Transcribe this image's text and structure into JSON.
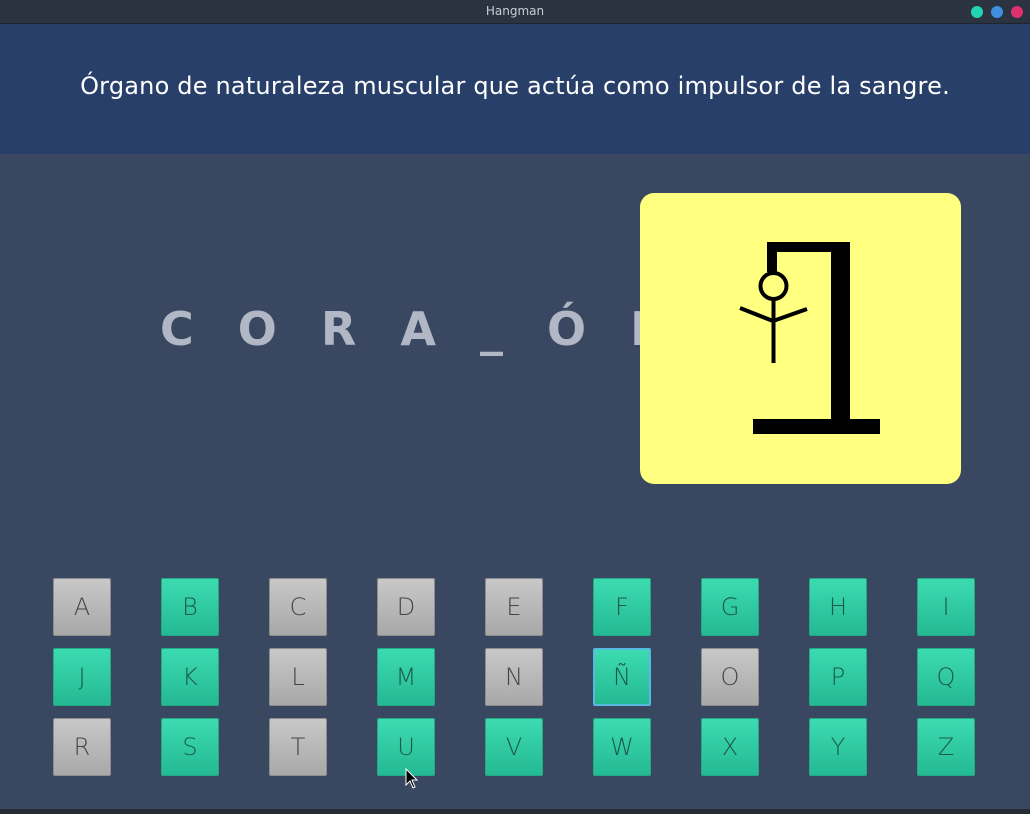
{
  "window": {
    "title": "Hangman",
    "controls": [
      {
        "name": "minimize",
        "color": "#22d3b4"
      },
      {
        "name": "maximize",
        "color": "#3e8fe0"
      },
      {
        "name": "close",
        "color": "#e0306f"
      }
    ]
  },
  "clue": "Órgano de naturaleza muscular que actúa como impulsor de la sangre.",
  "word_display": "C O R A _ Ó N",
  "hangman": {
    "stage_parts": [
      "base",
      "pole",
      "beam",
      "rope",
      "head",
      "arms",
      "body"
    ],
    "card_color": "#ffff80"
  },
  "keyboard": {
    "rows": [
      [
        {
          "letter": "A",
          "state": "used"
        },
        {
          "letter": "B",
          "state": "available"
        },
        {
          "letter": "C",
          "state": "used"
        },
        {
          "letter": "D",
          "state": "used"
        },
        {
          "letter": "E",
          "state": "used"
        },
        {
          "letter": "F",
          "state": "available"
        },
        {
          "letter": "G",
          "state": "available"
        },
        {
          "letter": "H",
          "state": "available"
        },
        {
          "letter": "I",
          "state": "available"
        }
      ],
      [
        {
          "letter": "J",
          "state": "available"
        },
        {
          "letter": "K",
          "state": "available"
        },
        {
          "letter": "L",
          "state": "used"
        },
        {
          "letter": "M",
          "state": "available"
        },
        {
          "letter": "N",
          "state": "used"
        },
        {
          "letter": "Ñ",
          "state": "available",
          "focused": true
        },
        {
          "letter": "O",
          "state": "used"
        },
        {
          "letter": "P",
          "state": "available"
        },
        {
          "letter": "Q",
          "state": "available"
        }
      ],
      [
        {
          "letter": "R",
          "state": "used"
        },
        {
          "letter": "S",
          "state": "available"
        },
        {
          "letter": "T",
          "state": "used"
        },
        {
          "letter": "U",
          "state": "available"
        },
        {
          "letter": "V",
          "state": "available"
        },
        {
          "letter": "W",
          "state": "available"
        },
        {
          "letter": "X",
          "state": "available"
        },
        {
          "letter": "Y",
          "state": "available"
        },
        {
          "letter": "Z",
          "state": "available"
        }
      ]
    ]
  }
}
